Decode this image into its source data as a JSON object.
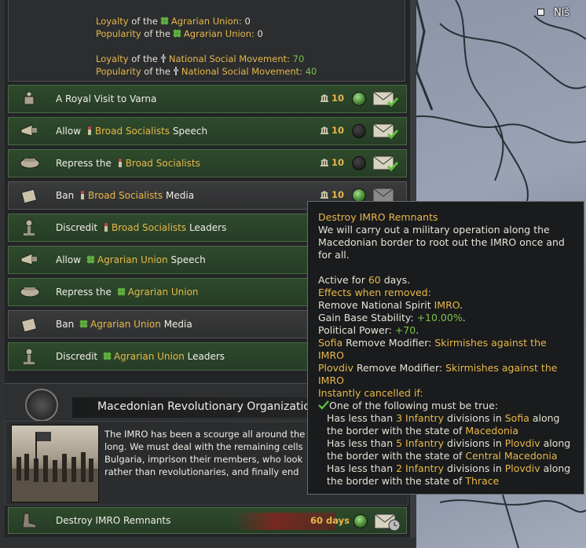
{
  "map": {
    "city": "Niš"
  },
  "stats": [
    {
      "label_a": "Loyalty",
      "label_of": "of the",
      "party": "Agrarian Union",
      "value": "0",
      "value_color": "white"
    },
    {
      "label_a": "Popularity",
      "label_of": "of the",
      "party": "Agrarian Union",
      "value": "0",
      "value_color": "white"
    },
    {
      "label_a": "Loyalty",
      "label_of": "of the",
      "party": "National Social Movement",
      "value": "70",
      "value_color": "green"
    },
    {
      "label_a": "Popularity",
      "label_of": "of the",
      "party": "National Social Movement",
      "value": "40",
      "value_color": "green"
    }
  ],
  "decisions": [
    {
      "pre": "A Royal Visit to Varna",
      "party": "",
      "post": "",
      "cost": "10",
      "style": "green",
      "orb": "green"
    },
    {
      "pre": "Allow",
      "party": "Broad Socialists",
      "post": "Speech",
      "cost": "10",
      "style": "green",
      "orb": "dark"
    },
    {
      "pre": "Repress the",
      "party": "Broad Socialists",
      "post": "",
      "cost": "10",
      "style": "green",
      "orb": "dark"
    },
    {
      "pre": "Ban",
      "party": "Broad Socialists",
      "post": "Media",
      "cost": "10",
      "style": "grey",
      "orb": "green"
    },
    {
      "pre": "Discredit",
      "party": "Broad Socialists",
      "post": "Leaders",
      "cost": "",
      "style": "green",
      "orb": ""
    },
    {
      "pre": "Allow",
      "party": "Agrarian Union",
      "post": "Speech",
      "cost": "",
      "style": "green",
      "orb": ""
    },
    {
      "pre": "Repress the",
      "party": "Agrarian Union",
      "post": "",
      "cost": "",
      "style": "green",
      "orb": ""
    },
    {
      "pre": "Ban",
      "party": "Agrarian Union",
      "post": "Media",
      "cost": "",
      "style": "grey",
      "orb": ""
    },
    {
      "pre": "Discredit",
      "party": "Agrarian Union",
      "post": "Leaders",
      "cost": "",
      "style": "green",
      "orb": ""
    }
  ],
  "category": {
    "title": "Macedonian Revolutionary Organizatio",
    "description": [
      "The IMRO has been a scourge all around the",
      "long. We must deal with the remaining cells",
      "Bulgaria, imprison their members, who look",
      "rather than revolutionaries, and finally end"
    ]
  },
  "mission": {
    "title": "Destroy IMRO Remnants",
    "days": "60 days"
  },
  "tooltip": {
    "title": "Destroy IMRO Remnants",
    "desc": [
      "We will carry out a military operation along the",
      "Macedonian border to root out the IMRO once and",
      "for all."
    ],
    "active_pre": "Active for ",
    "active_days": "60",
    "active_post": " days.",
    "effects_header": "Effects when removed:",
    "remove_spirit_pre": "Remove National Spirit ",
    "remove_spirit_name": "IMRO",
    "stability_pre": "Gain Base Stability: ",
    "stability_val": "+10.00%",
    "pp_pre": "Political Power: ",
    "pp_val": "+70",
    "mod1_state": "Sofia",
    "mod_text": " Remove Modifier: ",
    "mod1_name": "Skirmishes against the",
    "mod1_name2": "IMRO",
    "mod2_state": "Plovdiv",
    "mod2_name": "Skirmishes against the",
    "mod2_name2": "IMRO",
    "cancel_header": "Instantly cancelled if:",
    "must_be_true": "One of the following must be true:",
    "cond1a_pre": "Has less than ",
    "cond1a_num": "3 Infantry",
    "cond1a_mid": " divisions in ",
    "cond1a_state": "Sofia",
    "cond1a_post": " along",
    "cond1b_pre": "the border with the state of ",
    "cond1b_state": "Macedonia",
    "cond2a_pre": "Has less than ",
    "cond2a_num": "5 Infantry",
    "cond2a_mid": " divisions in ",
    "cond2a_state": "Plovdiv",
    "cond2a_post": " along",
    "cond2b_pre": "the border with the state of ",
    "cond2b_state": "Central Macedonia",
    "cond3a_pre": "Has less than ",
    "cond3a_num": "2 Infantry",
    "cond3a_mid": " divisions in ",
    "cond3a_state": "Plovdiv",
    "cond3a_post": " along",
    "cond3b_pre": "the border with the state of ",
    "cond3b_state": "Thrace"
  }
}
